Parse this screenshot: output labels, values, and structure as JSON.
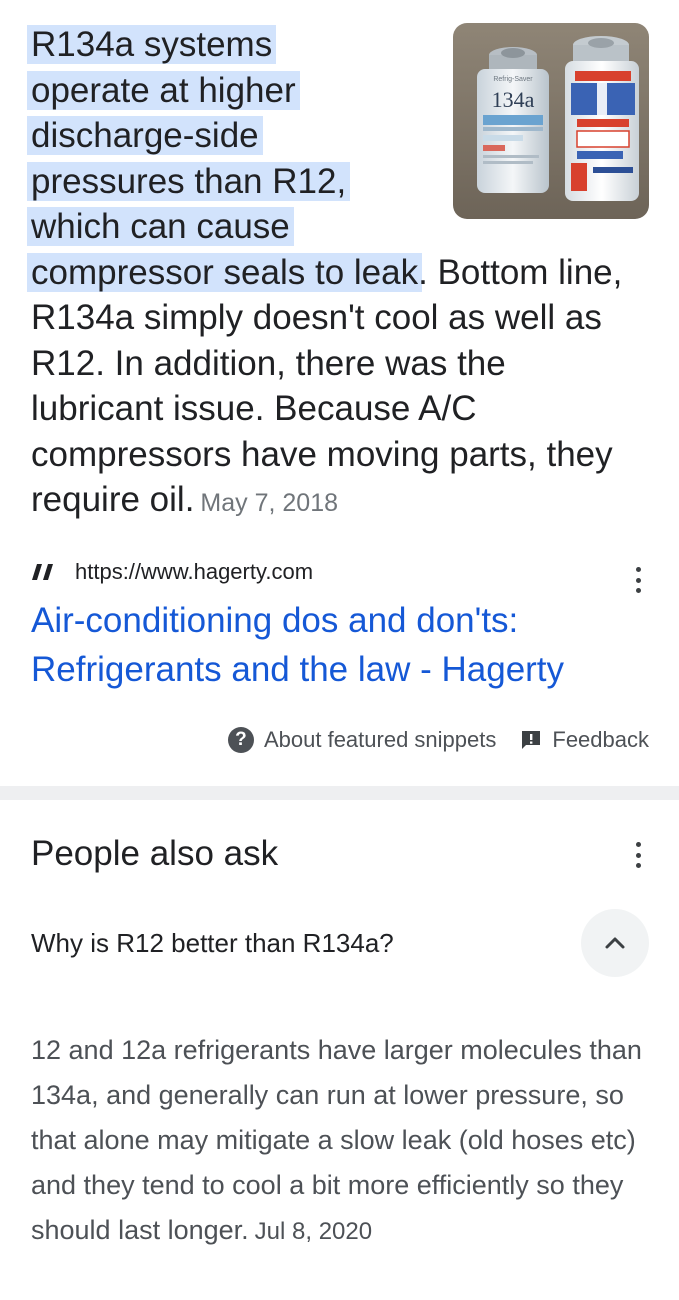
{
  "snippet": {
    "highlight_lines": [
      "R134a systems",
      "operate at higher",
      "discharge-side",
      "pressures than R12,",
      "which can cause"
    ],
    "highlight_last": "compressor seals to leak",
    "text_rest": ". Bottom line, R134a simply doesn't cool as well as R12. In addition, there was the lubricant issue. Because A/C compressors have moving parts, they require oil.",
    "date": "May 7, 2018",
    "image_icon": "refrigerant-cans-photo",
    "image_labels": {
      "can_left": "134a",
      "can_left_brand": "Refrig-Saver"
    }
  },
  "source": {
    "favicon": "hagerty-favicon-icon",
    "url": "https://www.hagerty.com",
    "title": "Air-conditioning dos and don'ts: Refrigerants and the law - Hagerty"
  },
  "footer": {
    "about": "About featured snippets",
    "feedback": "Feedback"
  },
  "paa": {
    "title": "People also ask",
    "question": "Why is R12 better than R134a?",
    "answer": "12 and 12a refrigerants have larger molecules than 134a, and generally can run at lower pressure, so that alone may mitigate a slow leak (old hoses etc) and they tend to cool a bit more efficiently so they should last longer.",
    "answer_date": "Jul 8, 2020"
  },
  "colors": {
    "highlight": "#d2e3fc",
    "link": "#1558d6",
    "text": "#202124",
    "muted": "#70757a"
  }
}
